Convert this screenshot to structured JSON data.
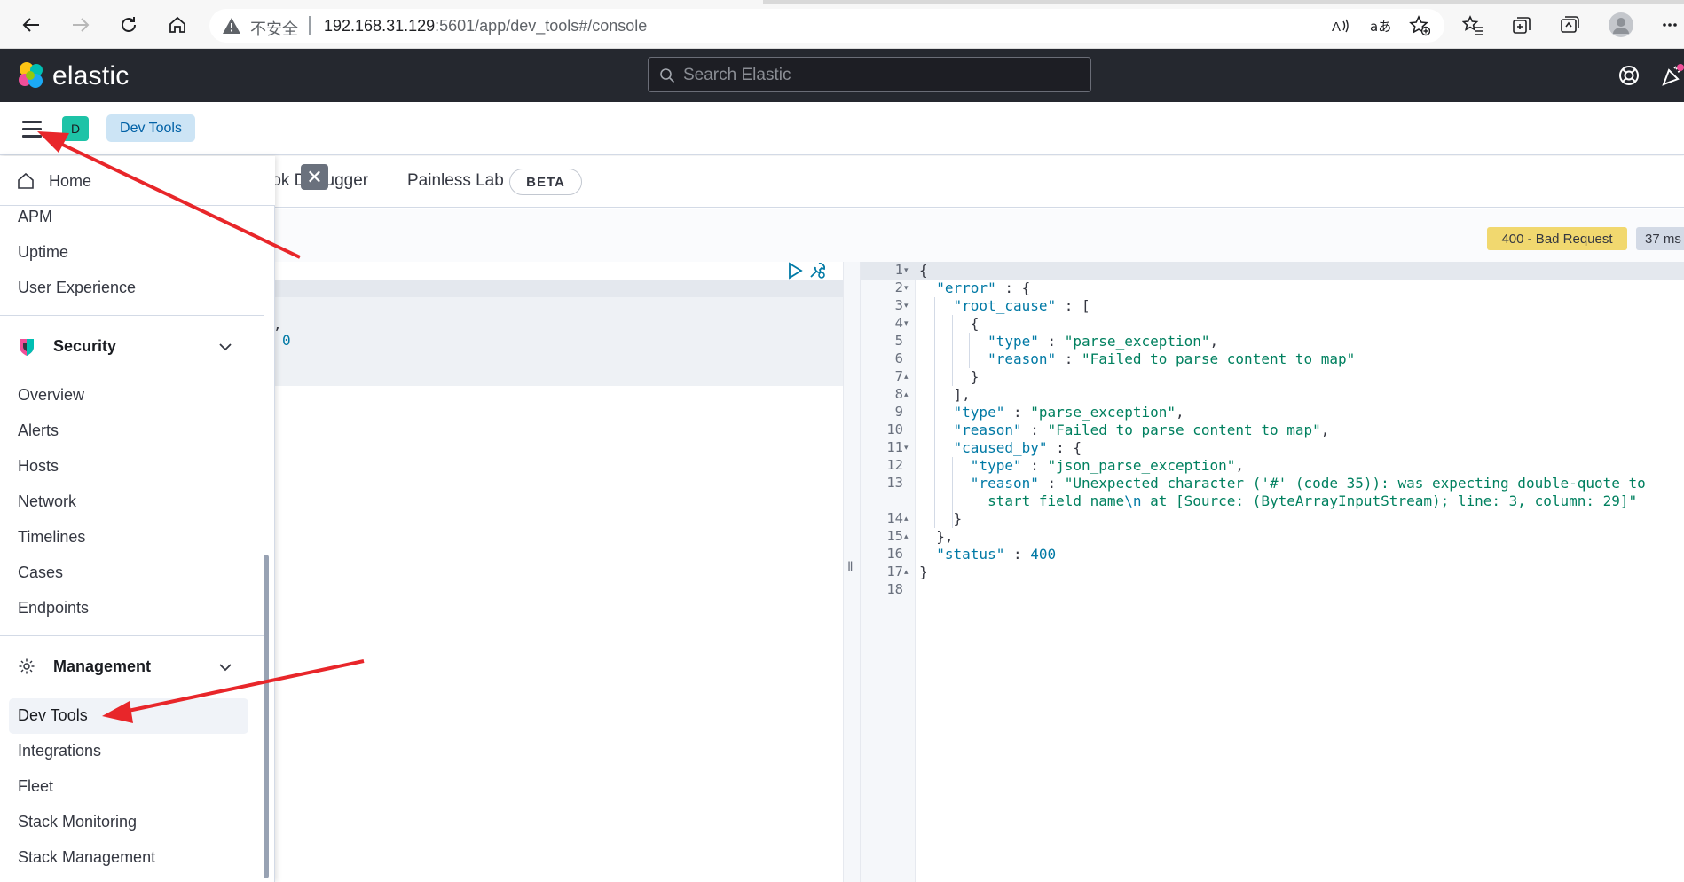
{
  "browser": {
    "insecure_label": "不安全",
    "url_host": "192.168.31.129",
    "url_rest": ":5601/app/dev_tools#/console"
  },
  "header": {
    "logo_text": "elastic",
    "search_placeholder": "Search Elastic"
  },
  "breadcrumb": {
    "space_initial": "D",
    "current": "Dev Tools"
  },
  "devtools": {
    "tabs": [
      "rok Debugger",
      "Painless Lab"
    ],
    "beta_badge": "BETA",
    "status_badge": "400 - Bad Request",
    "time_badge": "37 ms",
    "request_fragments": [
      ",",
      "0"
    ]
  },
  "response": {
    "line_numbers": [
      "1",
      "2",
      "3",
      "4",
      "5",
      "6",
      "7",
      "8",
      "9",
      "10",
      "11",
      "12",
      "13",
      "14",
      "15",
      "16",
      "17",
      "18"
    ]
  },
  "side_nav": {
    "home": "Home",
    "observability_items": [
      "APM",
      "Uptime",
      "User Experience"
    ],
    "security_title": "Security",
    "security_items": [
      "Overview",
      "Alerts",
      "Hosts",
      "Network",
      "Timelines",
      "Cases",
      "Endpoints"
    ],
    "management_title": "Management",
    "management_items": [
      "Dev Tools",
      "Integrations",
      "Fleet",
      "Stack Monitoring",
      "Stack Management"
    ]
  },
  "colors": {
    "header_bg": "#25282f",
    "accent": "#0061a6",
    "status_warning": "#f1d86f",
    "space_avatar": "#1ec3a7",
    "annotation_arrow": "#e8262a"
  }
}
